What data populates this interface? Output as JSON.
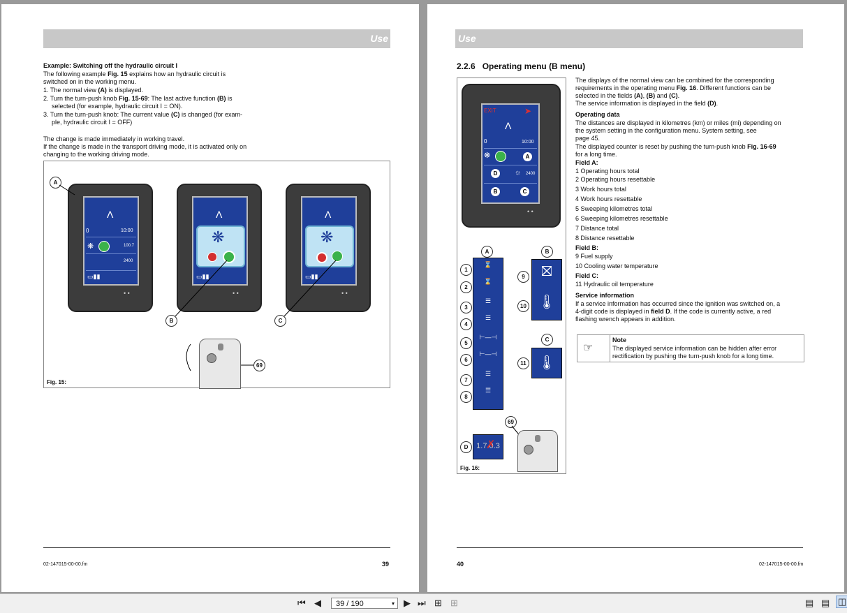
{
  "left_page": {
    "header": "Use",
    "example_title": "Example: Switching off the hydraulic circuit I",
    "intro_line1_pre": "The following example ",
    "intro_line1_ref": "Fig. 15",
    "intro_line1_post": " explains how an hydraulic circuit is",
    "intro_line2": "switched on in the working menu.",
    "step1_pre": "1. The normal view ",
    "step1_ref": "(A)",
    "step1_post": " is displayed.",
    "step2_pre": "2. Turn the turn-push knob ",
    "step2_ref": "Fig. 15-69",
    "step2_mid": ": The last active function ",
    "step2_ref2": "(B)",
    "step2_post": " is",
    "step2_line2": "selected (for example, hydraulic circuit I = ON).",
    "step3_pre": "3. Turn the turn-push knob: The current value ",
    "step3_ref": "(C)",
    "step3_post": " is changed (for exam-",
    "step3_line2": "ple, hydraulic circuit I = OFF)",
    "para1": "The change is made immediately in working travel.",
    "para2a": "If the change is made in the transport driving mode, it is activated only on",
    "para2b": "changing to the working driving mode.",
    "figure": {
      "label": "Fig. 15:",
      "callouts": [
        "A",
        "B",
        "C",
        "69"
      ],
      "screen_time": "10:00",
      "screen_rpm": "2400",
      "screen_zero": "0",
      "screen_val": "100.7"
    },
    "footer_code": "02-147015-00-00.fm",
    "page_number": "39"
  },
  "right_page": {
    "header": "Use",
    "section_number": "2.2.6",
    "section_title": "Operating menu (B menu)",
    "intro1": "The displays of the normal view can be combined for the corresponding",
    "intro2_pre": "requirements in the operating menu ",
    "intro2_ref": "Fig. 16",
    "intro2_post": ". Different functions can be",
    "intro3_pre": "selected in the fields ",
    "intro3_a": "(A)",
    "intro3_sep1": ", ",
    "intro3_b": "(B)",
    "intro3_and": " and ",
    "intro3_c": "(C)",
    "intro3_end": ".",
    "intro4_pre": "The service information is displayed in the field ",
    "intro4_ref": "(D)",
    "intro4_end": ".",
    "operating_data_heading": "Operating data",
    "od1": "The distances are displayed in kilometres (km) or miles (mi) depending on",
    "od2": "the system setting in the configuration menu. System setting, see",
    "od3": "page 45.",
    "od4_pre": "The displayed counter is reset by pushing the turn-push knob ",
    "od4_ref": "Fig. 16-69",
    "od5": "for a long time.",
    "field_a_heading": "Field A:",
    "field_a_items": [
      "1  Operating hours total",
      "2  Operating hours resettable",
      "3  Work hours total",
      "4  Work hours resettable",
      "5  Sweeping kilometres total",
      "6  Sweeping kilometres resettable",
      "7  Distance total",
      "8  Distance resettable"
    ],
    "field_b_heading": "Field B:",
    "field_b_items": [
      "9  Fuel supply",
      "10 Cooling water temperature"
    ],
    "field_c_heading": "Field C:",
    "field_c_items": [
      "11 Hydraulic oil temperature"
    ],
    "service_heading": "Service information",
    "si1": "If a service information has occurred since the ignition was switched on, a",
    "si2_pre": "4-digit code is displayed in ",
    "si2_ref": "field D",
    "si2_post": ". If the code is currently active, a red",
    "si3": "flashing wrench appears in addition.",
    "note_title": "Note",
    "note_line1": "The displayed service information can be hidden after error",
    "note_line2": "rectification by pushing the turn-push knob for a long time.",
    "figure": {
      "label": "Fig. 16:",
      "exit_label": "EXIT",
      "time": "10:00",
      "rpm": "2400",
      "zero": "0",
      "code": "1.7.0.3",
      "field_letters": [
        "A",
        "B",
        "C",
        "D"
      ],
      "numbers": [
        "1",
        "2",
        "3",
        "4",
        "5",
        "6",
        "7",
        "8",
        "9",
        "10",
        "11",
        "69"
      ]
    },
    "page_number": "40",
    "footer_code": "02-147015-00-00.fm"
  },
  "toolbar": {
    "page_indicator": "39 / 190"
  },
  "colors": {
    "screen_blue": "#1f3f9a",
    "header_gray": "#c8c8c8",
    "green": "#3bb24a",
    "red": "#d32f2f"
  }
}
